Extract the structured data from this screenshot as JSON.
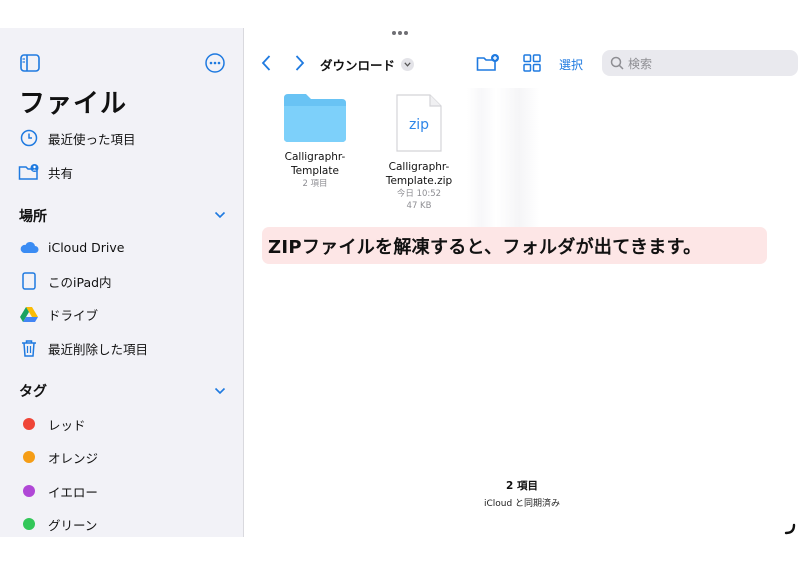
{
  "sidebar": {
    "title": "ファイル",
    "recent": "最近使った項目",
    "shared": "共有",
    "locations_header": "場所",
    "locations": [
      {
        "label": "iCloud Drive",
        "icon": "icloud-icon"
      },
      {
        "label": "このiPad内",
        "icon": "ipad-icon"
      },
      {
        "label": "ドライブ",
        "icon": "google-drive-icon"
      },
      {
        "label": "最近削除した項目",
        "icon": "trash-icon"
      }
    ],
    "tags_header": "タグ",
    "tags": [
      {
        "label": "レッド",
        "color": "#ef4537"
      },
      {
        "label": "オレンジ",
        "color": "#f59d16"
      },
      {
        "label": "イエロー",
        "color": "#b047d6"
      },
      {
        "label": "グリーン",
        "color": "#33c759"
      }
    ]
  },
  "toolbar": {
    "location_title": "ダウンロード",
    "select_label": "選択",
    "search_placeholder": "検索"
  },
  "files": [
    {
      "name": "Calligraphr-\nTemplate",
      "meta1": "2 項目",
      "meta2": "",
      "type": "folder"
    },
    {
      "name": "Calligraphr-\nTemplate.zip",
      "meta1": "今日 10:52",
      "meta2": "47 KB",
      "type": "zip",
      "icon_text": "zip"
    }
  ],
  "annotation": "ZIPファイルを解凍すると、フォルダが出てきます。",
  "footer": {
    "count": "2 項目",
    "sync": "iCloud と同期済み"
  },
  "colors": {
    "accent": "#1f7ae0",
    "sidebar_bg": "#f2f2f7",
    "annotation_bg": "#fde6e6",
    "folder": "#6cc4f5"
  }
}
